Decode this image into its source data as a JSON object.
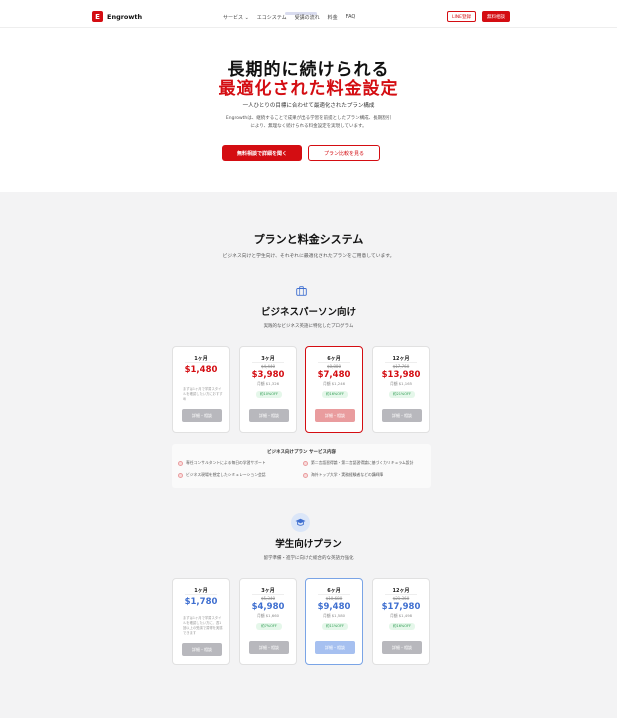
{
  "header": {
    "brand": "Engrowth",
    "logo_letter": "E",
    "nav": [
      "サービス ⌄",
      "エコシステム",
      "受講の流れ",
      "料金",
      "FAQ"
    ],
    "line_btn": "LINE登録",
    "free_btn": "無料相談"
  },
  "hero": {
    "title_line1": "長期的に続けられる",
    "title_line2": "最適化された料金設定",
    "subtitle": "一人ひとりの目標に合わせて最適化されたプラン構成",
    "desc_line1": "Engrowthは、継続することで成果が出る学習を前提としたプラン構成、長期割引",
    "desc_line2": "により、無理なく続けられる料金設定を実現しています。",
    "primary_btn": "無料相談で詳細を聞く",
    "secondary_btn": "プラン比較を見る"
  },
  "plans": {
    "title": "プランと料金システム",
    "subtitle": "ビジネス向けと学生向け、それぞれに最適化されたプランをご用意しています。",
    "business": {
      "title": "ビジネスパーソン向け",
      "subtitle": "実践的なビジネス英語に特化したプログラム",
      "cards": [
        {
          "period": "1ヶ月",
          "old": "",
          "price": "$1,480",
          "monthly": "",
          "note": "まずは1ヶ月で学習スタイルを確認したい方におすすめ",
          "off": "",
          "cta": "詳細・相談"
        },
        {
          "period": "3ヶ月",
          "old": "$4,440",
          "price": "$3,980",
          "monthly": "月額 $1,326",
          "note": "",
          "off": "約10%OFF",
          "cta": "詳細・相談"
        },
        {
          "period": "6ヶ月",
          "old": "$8,880",
          "price": "$7,480",
          "monthly": "月額 $1,246",
          "note": "",
          "off": "約16%OFF",
          "cta": "詳細・相談"
        },
        {
          "period": "12ヶ月",
          "old": "$17,760",
          "price": "$13,980",
          "monthly": "月額 $1,165",
          "note": "",
          "off": "約21%OFF",
          "cta": "詳細・相談"
        }
      ],
      "services_title": "ビジネス向けプラン サービス内容",
      "services": [
        "専任コンサルタントによる毎日の学習サポート",
        "ビジネス現場を想定したシミュレーション会話",
        "第二言語習得論・第二言語習得論に基づくカリキュラム設計",
        "海外トップ大学・実務経験者などの講師陣"
      ]
    },
    "student": {
      "title": "学生向けプラン",
      "subtitle": "留学準備・進学に向けた総合的な英語力強化",
      "cards": [
        {
          "period": "1ヶ月",
          "old": "",
          "price": "$1,780",
          "monthly": "",
          "note": "まずは1ヶ月で学習スタイルを確認したい方に、週1回以上の受講で習得を実感できます",
          "off": "",
          "cta": "詳細・相談"
        },
        {
          "period": "3ヶ月",
          "old": "$5,340",
          "price": "$4,980",
          "monthly": "月額 $1,660",
          "note": "",
          "off": "約7%OFF",
          "cta": "詳細・相談"
        },
        {
          "period": "6ヶ月",
          "old": "$10,680",
          "price": "$9,480",
          "monthly": "月額 $1,580",
          "note": "",
          "off": "約11%OFF",
          "cta": "詳細・相談"
        },
        {
          "period": "12ヶ月",
          "old": "$21,360",
          "price": "$17,980",
          "monthly": "月額 $1,498",
          "note": "",
          "off": "約16%OFF",
          "cta": "詳細・相談"
        }
      ]
    }
  },
  "colors": {
    "brand_red": "#d40d12",
    "student_blue": "#3f6fd0",
    "offer_green": "#2c9a50"
  }
}
